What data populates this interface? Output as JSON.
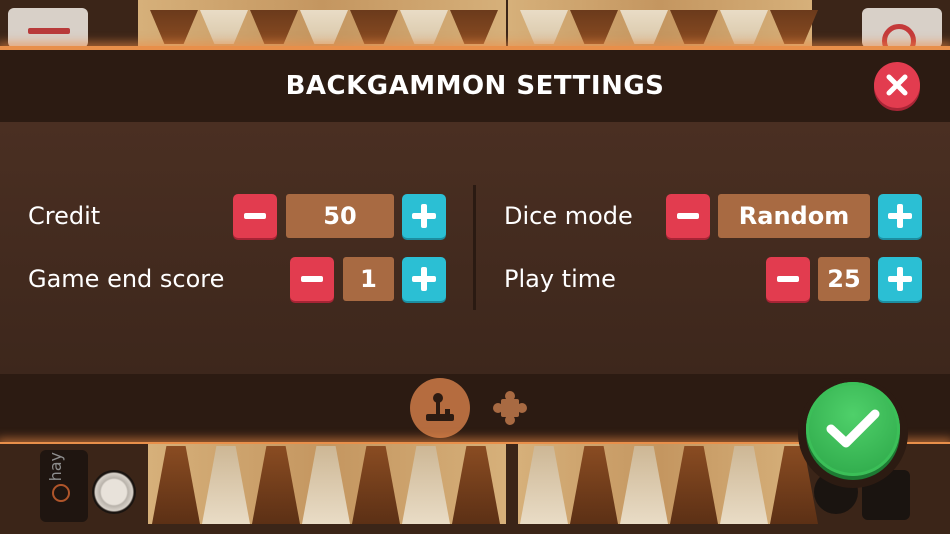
{
  "dialog": {
    "title": "BACKGAMMON SETTINGS"
  },
  "settings": {
    "credit": {
      "label": "Credit",
      "value": "50"
    },
    "game_end_score": {
      "label": "Game end score",
      "value": "1"
    },
    "dice_mode": {
      "label": "Dice mode",
      "value": "Random"
    },
    "play_time": {
      "label": "Play time",
      "value": "25"
    }
  },
  "background": {
    "side_player_text": "hay"
  },
  "colors": {
    "minus": "#e23c4f",
    "plus": "#2bbfd4",
    "value_box": "#a86a42",
    "confirm": "#2aa446",
    "close": "#e23c4f"
  },
  "icons": {
    "close": "close-icon",
    "minus": "minus-icon",
    "plus": "plus-icon",
    "game_tab": "joystick-icon",
    "rules_tab": "puzzle-icon",
    "confirm": "checkmark-icon"
  }
}
